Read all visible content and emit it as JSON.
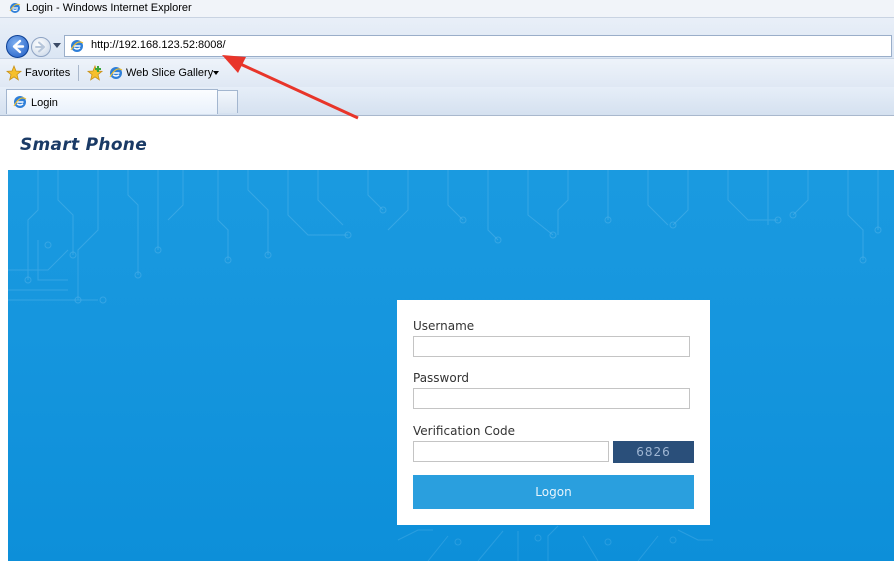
{
  "window": {
    "title": "Login - Windows Internet Explorer"
  },
  "address_bar": {
    "url": "http://192.168.123.52:8008/"
  },
  "favorites_bar": {
    "favorites_label": "Favorites",
    "web_slice_label": "Web Slice Gallery"
  },
  "tabs": [
    {
      "label": "Login"
    }
  ],
  "page": {
    "brand": "Smart Phone",
    "login": {
      "username_label": "Username",
      "username_value": "",
      "password_label": "Password",
      "password_value": "",
      "verification_label": "Verification Code",
      "verification_value": "",
      "captcha_code": "6826",
      "logon_button": "Logon"
    }
  },
  "icons": [
    "ie-logo-icon",
    "back-arrow-icon",
    "forward-arrow-icon",
    "star-icon",
    "add-favorite-icon"
  ],
  "colors": {
    "hero_blue": "#1696de",
    "captcha_bg": "#2a4f7a",
    "logon_bg": "#2a9fde",
    "annotation_arrow": "#e8352a"
  }
}
